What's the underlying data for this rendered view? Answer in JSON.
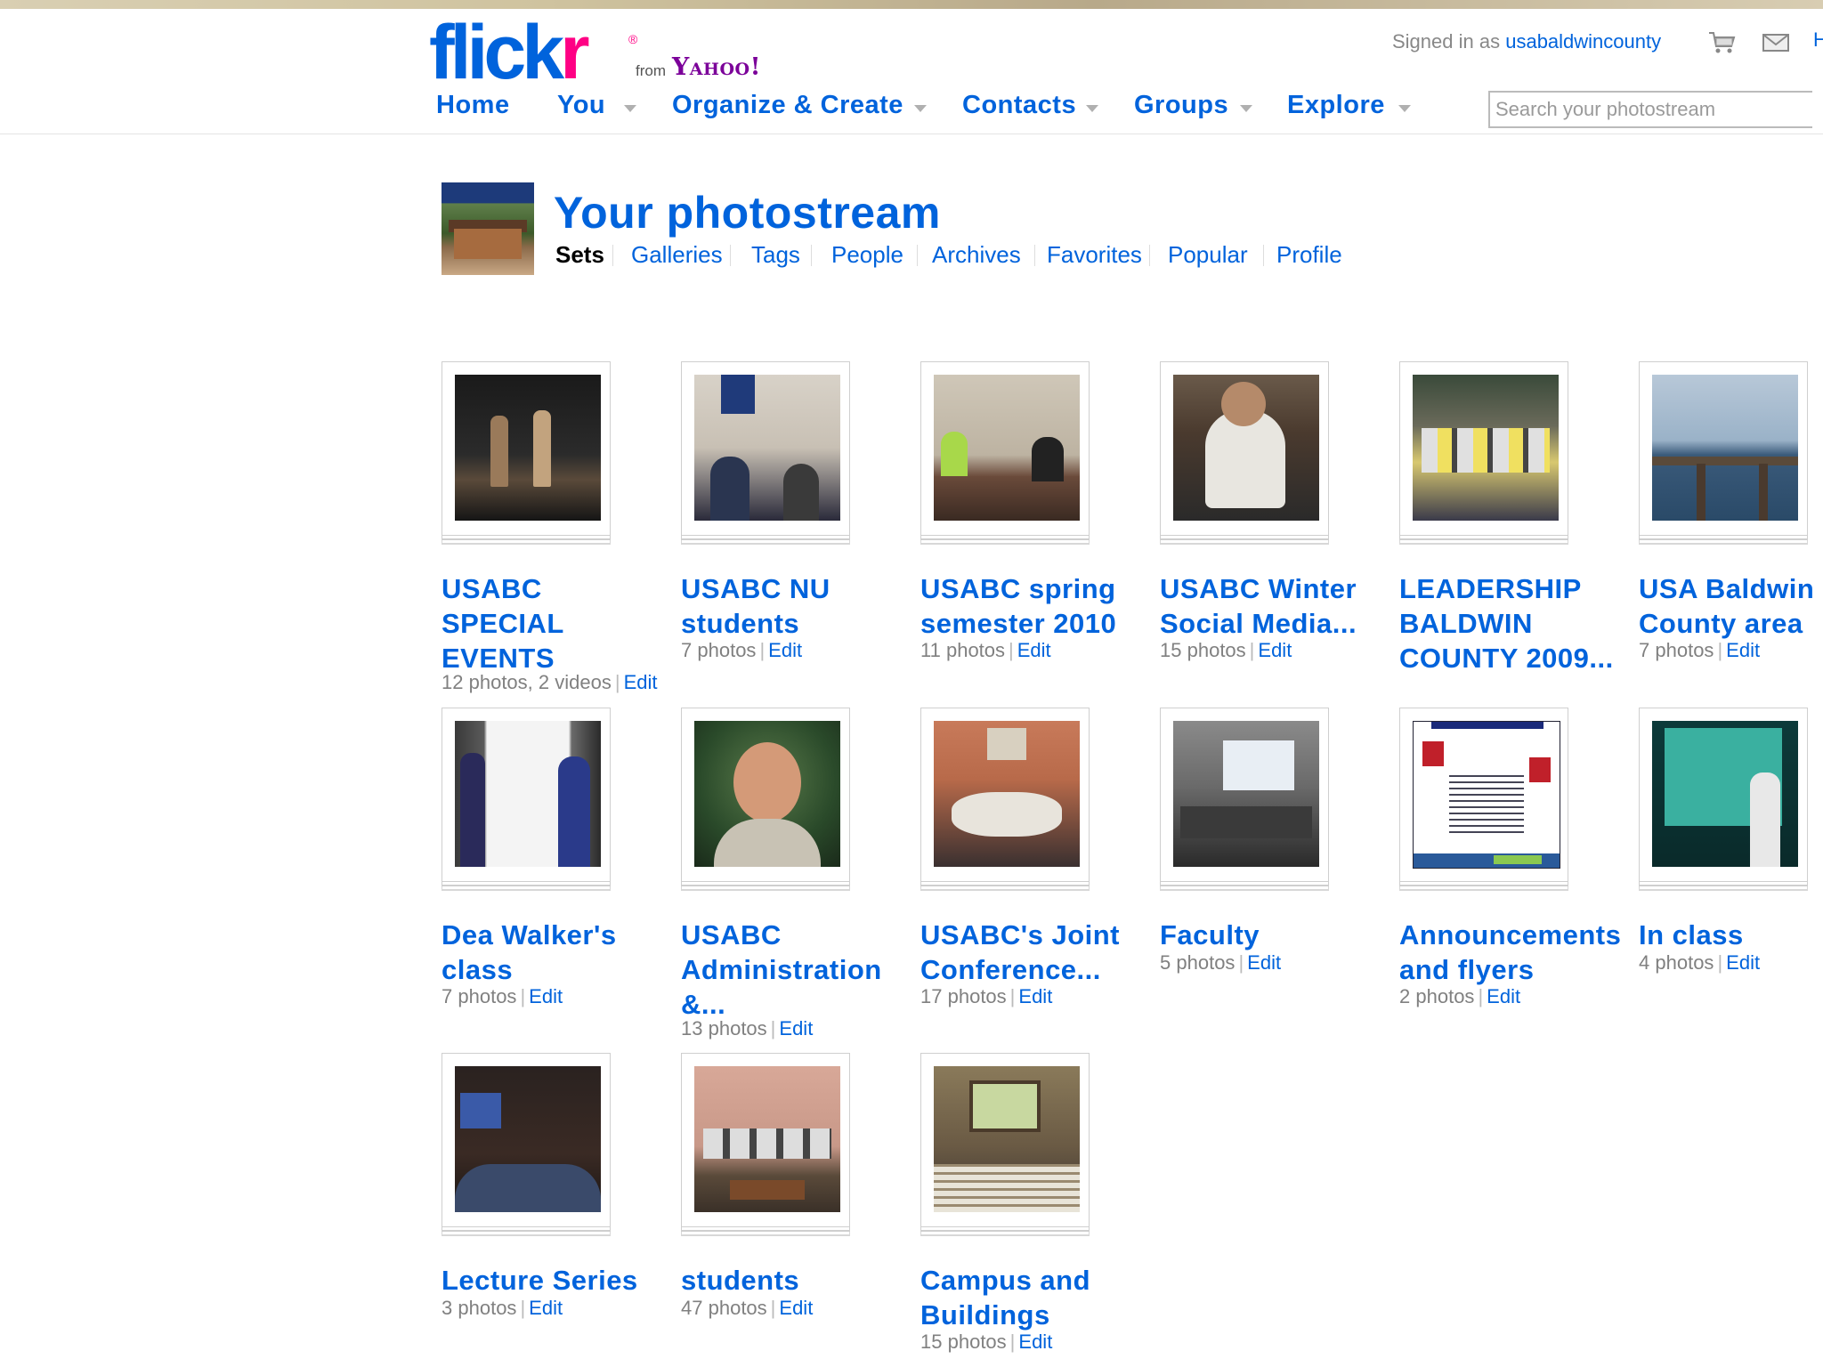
{
  "logo": {
    "flickr": "flick",
    "flickr_r": "r",
    "from": "from",
    "yahoo": "Yahoo!"
  },
  "header": {
    "signed_in_prefix": "Signed in as",
    "username": "usabaldwincounty",
    "cart_icon": "cart-icon",
    "mail_icon": "mail-icon",
    "more": "H"
  },
  "nav": {
    "items": [
      {
        "label": "Home",
        "has_menu": false
      },
      {
        "label": "You",
        "has_menu": true
      },
      {
        "label": "Organize & Create",
        "has_menu": true
      },
      {
        "label": "Contacts",
        "has_menu": true
      },
      {
        "label": "Groups",
        "has_menu": true
      },
      {
        "label": "Explore",
        "has_menu": true
      }
    ]
  },
  "search": {
    "placeholder": "Search your photostream",
    "value": ""
  },
  "page": {
    "title": "Your photostream",
    "tabs": [
      {
        "label": "Sets",
        "active": true
      },
      {
        "label": "Galleries"
      },
      {
        "label": "Tags"
      },
      {
        "label": "People"
      },
      {
        "label": "Archives"
      },
      {
        "label": "Favorites"
      },
      {
        "label": "Popular"
      },
      {
        "label": "Profile"
      }
    ]
  },
  "sets": [
    {
      "title": "USABC SPECIAL EVENTS",
      "count": "12",
      "count_unit": "photos,",
      "extra_count": "2",
      "extra_unit": "videos",
      "edit": "Edit",
      "image": "two musicians on stage"
    },
    {
      "title": "USABC NU students",
      "count": "7",
      "count_unit": "photos",
      "edit": "Edit",
      "image": "students at desk"
    },
    {
      "title": "USABC spring semester 2010",
      "count": "11",
      "count_unit": "photos",
      "edit": "Edit",
      "image": "classroom with students"
    },
    {
      "title": "USABC Winter Social Media...",
      "count": "15",
      "count_unit": "photos",
      "edit": "Edit",
      "image": "man using phone"
    },
    {
      "title": "LEADERSHIP BALDWIN COUNTY 2009...",
      "count": "",
      "count_unit": "",
      "edit": "",
      "image": "group photo"
    },
    {
      "title": "USA Baldwin County area",
      "count": "7",
      "count_unit": "photos",
      "edit": "Edit",
      "image": "pier with seagulls"
    },
    {
      "title": "Dea Walker's class",
      "count": "7",
      "count_unit": "photos",
      "edit": "Edit",
      "image": "teacher at whiteboard"
    },
    {
      "title": "USABC Administration &...",
      "count": "13",
      "count_unit": "photos",
      "edit": "Edit",
      "image": "woman portrait"
    },
    {
      "title": "USABC's Joint Conference...",
      "count": "17",
      "count_unit": "photos",
      "edit": "Edit",
      "image": "conference table meeting"
    },
    {
      "title": "Faculty",
      "count": "5",
      "count_unit": "photos",
      "edit": "Edit",
      "image": "faculty presentation"
    },
    {
      "title": "Announcements and flyers",
      "count": "2",
      "count_unit": "photos",
      "edit": "Edit",
      "image": "flyer document"
    },
    {
      "title": "In class",
      "count": "4",
      "count_unit": "photos",
      "edit": "Edit",
      "image": "class projection"
    },
    {
      "title": "Lecture Series",
      "count": "3",
      "count_unit": "photos",
      "edit": "Edit",
      "image": "lecture hall"
    },
    {
      "title": "students",
      "count": "47",
      "count_unit": "photos",
      "edit": "Edit",
      "image": "computer lab"
    },
    {
      "title": "Campus and Buildings",
      "count": "15",
      "count_unit": "photos",
      "edit": "Edit",
      "image": "office with window"
    }
  ]
}
